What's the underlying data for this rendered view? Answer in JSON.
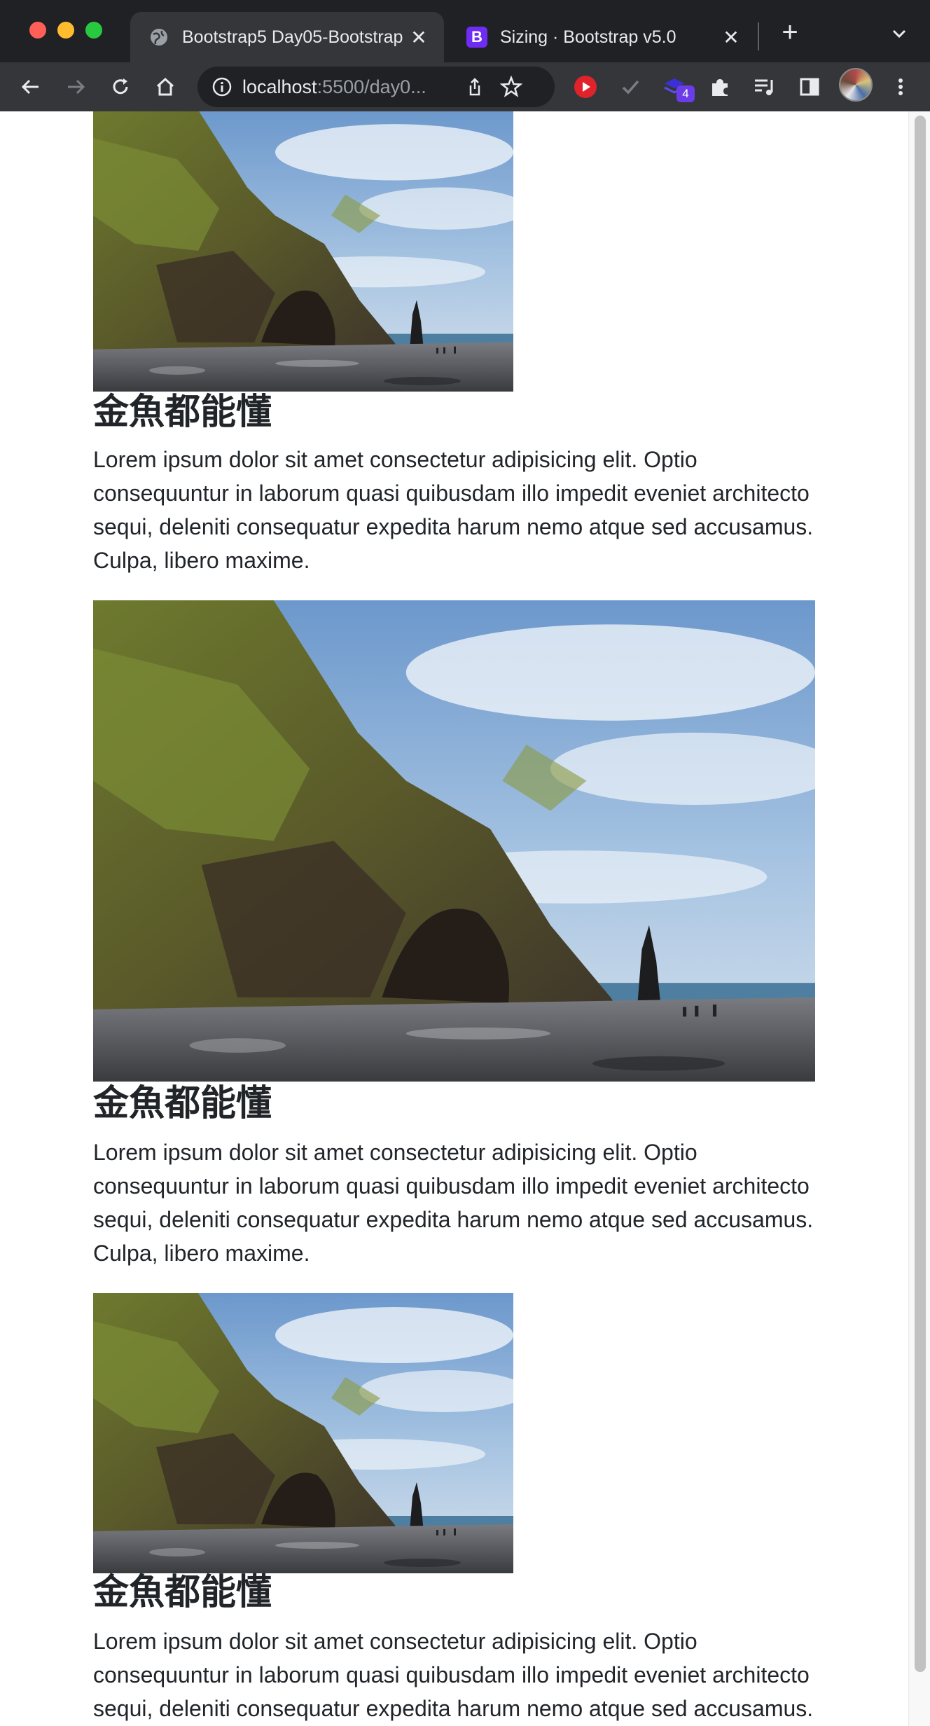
{
  "browser": {
    "tabs": [
      {
        "title": "Bootstrap5 Day05-Bootstrap",
        "favicon": "globe-icon",
        "active": true
      },
      {
        "title": "Sizing · Bootstrap v5.0",
        "favicon": "bootstrap-logo-icon",
        "active": false
      }
    ],
    "address": {
      "host": "localhost",
      "path": ":5500/day0..."
    },
    "bootstrap_favicon_letter": "B",
    "extension_badge": "4",
    "colors": {
      "chrome_dark": "#202124",
      "chrome_tab": "#35363a",
      "bootstrap_purple": "#7952b3",
      "youtube_red": "#e0232b"
    }
  },
  "page": {
    "cards": [
      {
        "image_alt": "Sea cliff with cave on a black pebble beach under a cloudy blue sky",
        "title": "金魚都能懂",
        "text": "Lorem ipsum dolor sit amet consectetur adipisicing elit. Optio consequuntur in laborum quasi quibusdam illo impedit eveniet architecto sequi, deleniti consequatur expedita harum nemo atque sed accusamus. Culpa, libero maxime."
      },
      {
        "image_alt": "Sea cliff with cave on a black pebble beach under a cloudy blue sky",
        "title": "金魚都能懂",
        "text": "Lorem ipsum dolor sit amet consectetur adipisicing elit. Optio consequuntur in laborum quasi quibusdam illo impedit eveniet architecto sequi, deleniti consequatur expedita harum nemo atque sed accusamus. Culpa, libero maxime."
      },
      {
        "image_alt": "Sea cliff with cave on a black pebble beach under a cloudy blue sky",
        "title": "金魚都能懂",
        "text": "Lorem ipsum dolor sit amet consectetur adipisicing elit. Optio consequuntur in laborum quasi quibusdam illo impedit eveniet architecto sequi, deleniti consequatur expedita harum nemo atque sed accusamus. Culpa, libero maxime."
      }
    ]
  }
}
